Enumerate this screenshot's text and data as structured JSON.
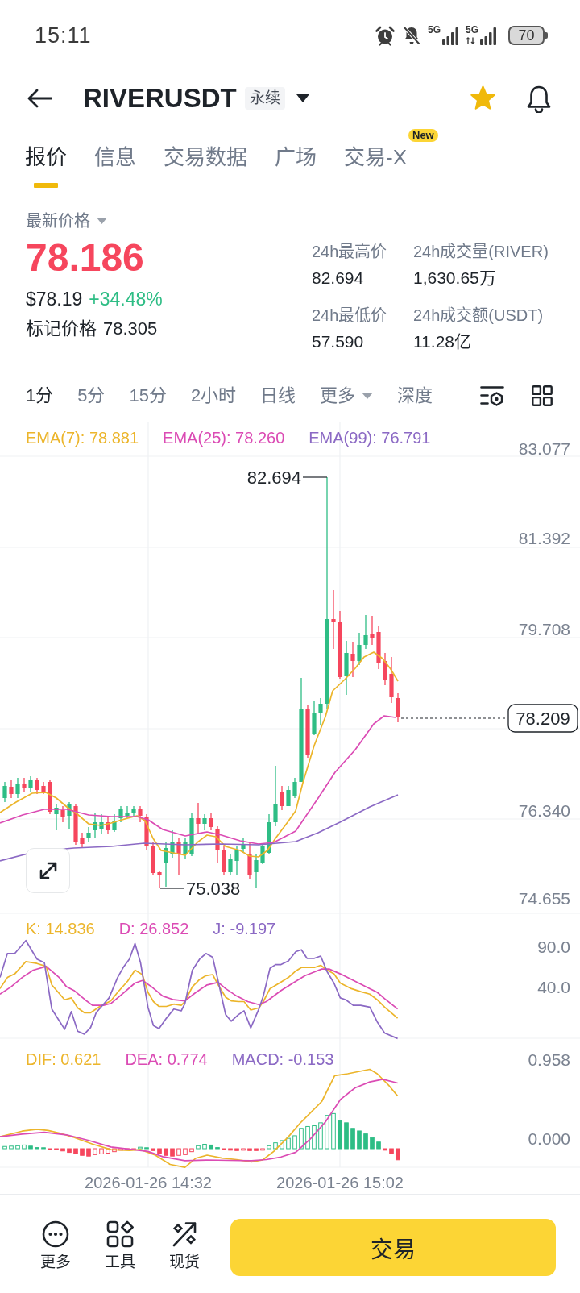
{
  "status_bar": {
    "time": "15:11",
    "signals": [
      {
        "label": "5G",
        "data_active": false
      },
      {
        "label": "5G",
        "data_active": true
      }
    ],
    "battery": "70"
  },
  "header": {
    "title": "RIVERUSDT",
    "badge": "永续",
    "favorite": true
  },
  "tabs": [
    {
      "label": "报价",
      "selected": true
    },
    {
      "label": "信息",
      "selected": false
    },
    {
      "label": "交易数据",
      "selected": false
    },
    {
      "label": "广场",
      "selected": false
    },
    {
      "label": "交易-X",
      "selected": false,
      "badge": "New"
    }
  ],
  "price": {
    "label": "最新价格",
    "last": "78.186",
    "last_up": false,
    "usd": "$78.19",
    "change": "+34.48%",
    "change_up": true,
    "mark_label": "标记价格",
    "mark_value": "78.305"
  },
  "stats": [
    {
      "label": "24h最高价",
      "value": "82.694"
    },
    {
      "label": "24h成交量(RIVER)",
      "value": "1,630.65万"
    },
    {
      "label": "24h最低价",
      "value": "57.590"
    },
    {
      "label": "24h成交额(USDT)",
      "value": "11.28亿"
    }
  ],
  "intervals": [
    {
      "label": "1分",
      "kind": "tab",
      "selected": true
    },
    {
      "label": "5分",
      "kind": "tab",
      "selected": false
    },
    {
      "label": "15分",
      "kind": "tab",
      "selected": false
    },
    {
      "label": "2小时",
      "kind": "tab",
      "selected": false
    },
    {
      "label": "日线",
      "kind": "tab",
      "selected": false
    },
    {
      "label": "更多",
      "kind": "menu",
      "selected": false
    },
    {
      "label": "深度",
      "kind": "tab",
      "selected": false
    }
  ],
  "chart": {
    "legend": [
      {
        "text": "EMA(7): 78.881",
        "color": "#ecb52b"
      },
      {
        "text": "EMA(25): 78.260",
        "color": "#db4bb4"
      },
      {
        "text": "EMA(99): 76.791",
        "color": "#8b69c4"
      }
    ],
    "price_axis": [
      "83.077",
      "81.392",
      "79.708",
      "76.340",
      "74.655"
    ],
    "high_label": "82.694",
    "low_label": "75.038",
    "last_price": "78.209"
  },
  "kdj": {
    "legend": [
      {
        "text": "K: 14.836",
        "color": "#ecb52b"
      },
      {
        "text": "D: 26.852",
        "color": "#db4bb4"
      },
      {
        "text": "J: -9.197",
        "color": "#8b69c4"
      }
    ],
    "axis": [
      "90.0",
      "40.0"
    ]
  },
  "macd": {
    "legend": [
      {
        "text": "DIF: 0.621",
        "color": "#ecb52b"
      },
      {
        "text": "DEA: 0.774",
        "color": "#db4bb4"
      },
      {
        "text": "MACD: -0.153",
        "color": "#8b69c4"
      }
    ],
    "axis": [
      "0.958",
      "0.000"
    ]
  },
  "time_axis": [
    "2026-01-26 14:32",
    "2026-01-26 15:02"
  ],
  "bottom_bar": {
    "actions": [
      {
        "label": "更多"
      },
      {
        "label": "工具"
      },
      {
        "label": "现货"
      }
    ],
    "trade_button": "交易"
  }
}
